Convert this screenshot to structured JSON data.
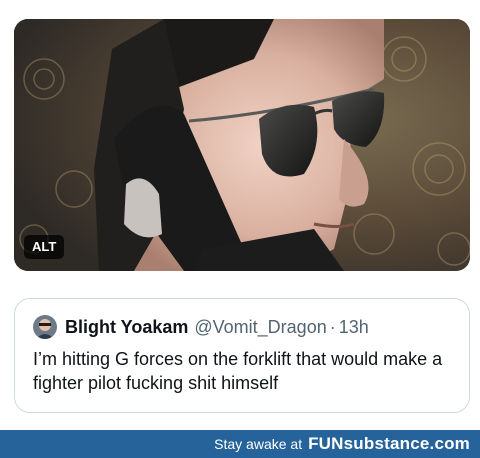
{
  "media": {
    "alt_badge": "ALT",
    "image_description_icon": "man-with-sunglasses-on-phone-photo"
  },
  "quote": {
    "author_name": "Blight Yoakam",
    "author_handle": "@Vomit_Dragon",
    "separator": "·",
    "time": "13h",
    "text": "I’m hitting G forces on the forklift that would make a fighter pilot fucking shit himself"
  },
  "footer": {
    "tagline": "Stay awake at",
    "brand": "FUNsubstance.com"
  },
  "colors": {
    "footer_bg": "#25639a",
    "text_primary": "#0f1419",
    "text_secondary": "#536471",
    "card_border": "#cfd9de"
  }
}
